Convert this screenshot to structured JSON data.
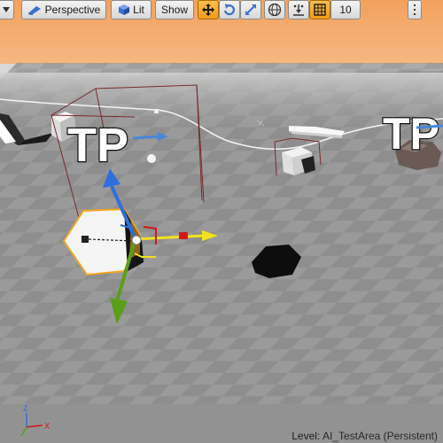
{
  "toolbar": {
    "perspective_label": "Perspective",
    "lit_label": "Lit",
    "show_label": "Show",
    "grid_snap_value": "10"
  },
  "scene": {
    "tp_label_left": "TP",
    "tp_label_right": "TP"
  },
  "axis_indicator": {
    "z": "Z",
    "x": "X"
  },
  "footer": {
    "level_prefix": "Level:",
    "level_name": "AI_TestArea (Persistent)"
  },
  "colors": {
    "sky": "#f0a868",
    "floor": "#8e8e8e",
    "active_button": "#f5a623",
    "gizmo_x": "#f2e21c",
    "gizmo_y": "#5a9e1a",
    "gizmo_z": "#2f6fdc"
  }
}
